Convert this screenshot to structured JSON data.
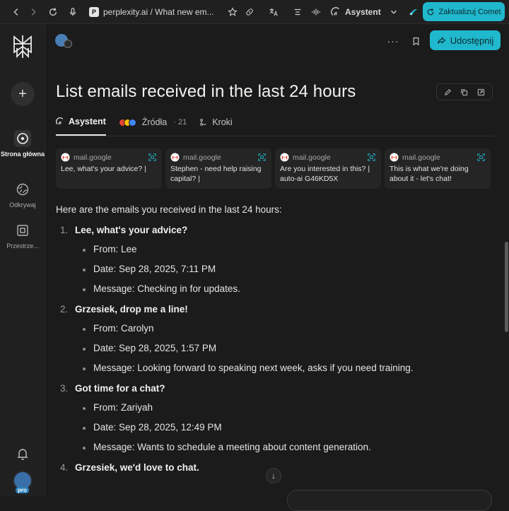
{
  "browser": {
    "url_text": "perplexity.ai / What new em...",
    "favicon_label": "P",
    "assistant_label": "Asystent",
    "upgrade_label": "Zaktualizuj Comet",
    "icons": [
      "back-icon",
      "forward-icon",
      "reload-icon",
      "mic-icon",
      "star-icon",
      "link-icon",
      "translate-icon",
      "reader-icon",
      "audio-icon",
      "assistant-icon",
      "chevron-down-icon",
      "comet-icon"
    ]
  },
  "sidebar": {
    "items": [
      {
        "label": "Strona główna",
        "icon": "home-icon",
        "active": true
      },
      {
        "label": "Odkrywaj",
        "icon": "discover-icon",
        "active": false
      },
      {
        "label": "Przestrze...",
        "icon": "spaces-icon",
        "active": false
      }
    ],
    "new_icon": "plus-icon",
    "bell_icon": "bell-icon",
    "pro_label": "pro"
  },
  "header": {
    "share_label": "Udostępnij",
    "more_label": "···"
  },
  "thread": {
    "title": "List emails received in the last 24 hours",
    "tabs": [
      {
        "label": "Asystent",
        "active": true
      },
      {
        "label": "Źródła",
        "count": "· 21",
        "active": false
      },
      {
        "label": "Kroki",
        "active": false
      }
    ],
    "sources": [
      {
        "site": "mail.google",
        "title": "Lee, what's your advice? |"
      },
      {
        "site": "mail.google",
        "title": "Stephen - need help raising capital? |"
      },
      {
        "site": "mail.google",
        "title": "Are you interested in this? | auto-ai G46KD5X"
      },
      {
        "site": "mail.google",
        "title": "This is what we're doing about it - let's chat!"
      }
    ],
    "intro": "Here are the emails you received in the last 24 hours:",
    "emails": [
      {
        "num": "1.",
        "subject": "Lee, what's your advice?",
        "from": "From: Lee",
        "date": "Date: Sep 28, 2025, 7:11 PM",
        "message": "Message: Checking in for updates."
      },
      {
        "num": "2.",
        "subject": "Grzesiek, drop me a line!",
        "from": "From: Carolyn",
        "date": "Date: Sep 28, 2025, 1:57 PM",
        "message": "Message: Looking forward to speaking next week, asks if you need training."
      },
      {
        "num": "3.",
        "subject": "Got time for a chat?",
        "from": "From: Zariyah",
        "date": "Date: Sep 28, 2025, 12:49 PM",
        "message": "Message: Wants to schedule a meeting about content generation."
      },
      {
        "num": "4.",
        "subject": "Grzesiek, we'd love to chat."
      }
    ]
  },
  "colors": {
    "accent": "#20b8cd",
    "background": "#1b1b1b",
    "sidebar": "#202020",
    "card": "#252525"
  }
}
